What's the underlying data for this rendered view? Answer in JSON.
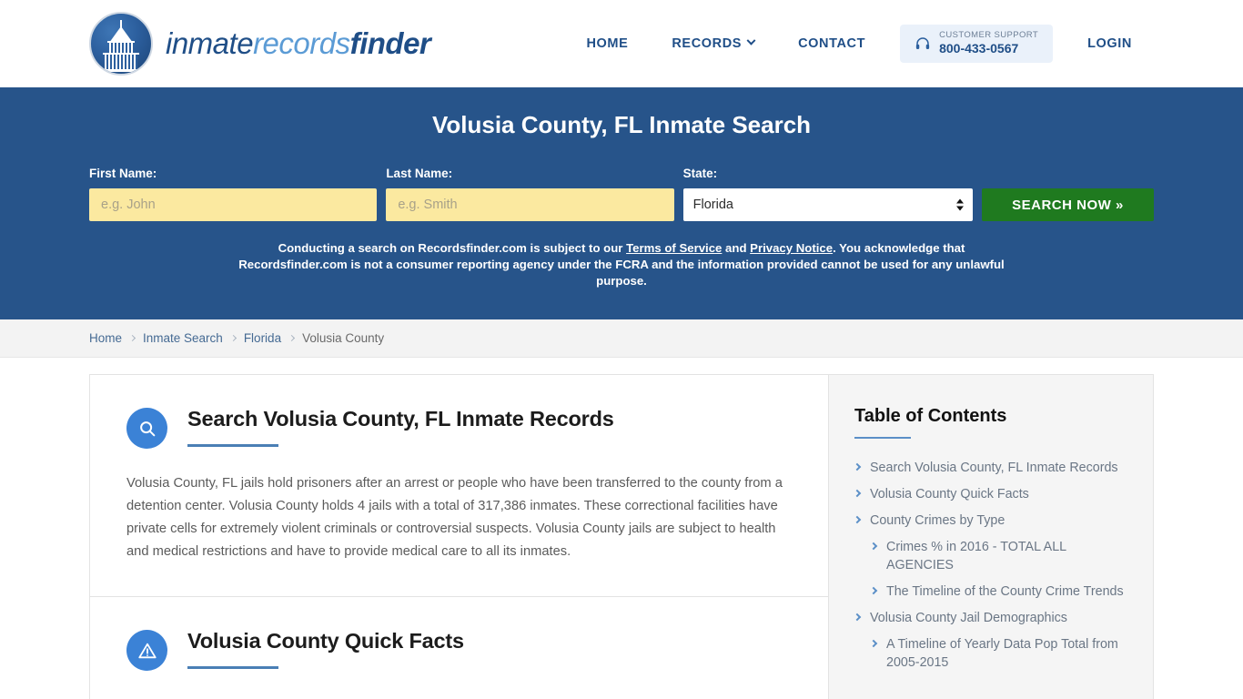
{
  "brand": {
    "part1": "inmate",
    "part2": "records",
    "part3": "finder",
    "logo_icon": "capitol-dome-icon"
  },
  "nav": {
    "items": [
      {
        "label": "HOME",
        "has_caret": false
      },
      {
        "label": "RECORDS",
        "has_caret": true
      },
      {
        "label": "CONTACT",
        "has_caret": false
      }
    ],
    "login_label": "LOGIN",
    "support": {
      "icon": "headset-icon",
      "label": "CUSTOMER SUPPORT",
      "phone": "800-433-0567"
    }
  },
  "hero": {
    "title": "Volusia County, FL Inmate Search",
    "bg_color": "#27548a",
    "form": {
      "first_name_label": "First Name:",
      "first_name_value": "",
      "first_name_placeholder": "e.g. John",
      "last_name_label": "Last Name:",
      "last_name_value": "",
      "last_name_placeholder": "e.g. Smith",
      "state_label": "State:",
      "state_value": "Florida",
      "search_button": "SEARCH NOW »"
    },
    "disclaimer": {
      "pre": "Conducting a search on Recordsfinder.com is subject to our ",
      "link1": "Terms of Service",
      "mid": " and ",
      "link2": "Privacy Notice",
      "post": ". You acknowledge that Recordsfinder.com is not a consumer reporting agency under the FCRA and the information provided cannot be used for any unlawful purpose."
    }
  },
  "breadcrumb": {
    "items": [
      "Home",
      "Inmate Search",
      "Florida"
    ],
    "active": "Volusia County"
  },
  "main": {
    "sections": [
      {
        "icon": "magnifier-icon",
        "title": "Search Volusia County, FL Inmate Records",
        "body": "Volusia County, FL jails hold prisoners after an arrest or people who have been transferred to the county from a detention center. Volusia County holds 4 jails with a total of 317,386 inmates. These correctional facilities have private cells for extremely violent criminals or controversial suspects. Volusia County jails are subject to health and medical restrictions and have to provide medical care to all its inmates."
      },
      {
        "icon": "warning-triangle-icon",
        "title": "Volusia County Quick Facts",
        "body": ""
      }
    ]
  },
  "sidebar": {
    "title": "Table of Contents",
    "items": [
      {
        "label": "Search Volusia County, FL Inmate Records",
        "level": 1
      },
      {
        "label": "Volusia County Quick Facts",
        "level": 1
      },
      {
        "label": "County Crimes by Type",
        "level": 1
      },
      {
        "label": "Crimes % in 2016 - TOTAL ALL AGENCIES",
        "level": 2
      },
      {
        "label": "The Timeline of the County Crime Trends",
        "level": 2
      },
      {
        "label": "Volusia County Jail Demographics",
        "level": 1
      },
      {
        "label": "A Timeline of Yearly Data Pop Total from 2005-2015",
        "level": 2
      }
    ]
  },
  "colors": {
    "brand_dark_blue": "#1f4e87",
    "brand_light_blue": "#5b9bd5",
    "hero_blue": "#27548a",
    "input_yellow": "#fbe9a0",
    "button_green": "#1f7a1f",
    "accent_blue": "#4a7fb5",
    "icon_blue": "#3b82d6"
  }
}
